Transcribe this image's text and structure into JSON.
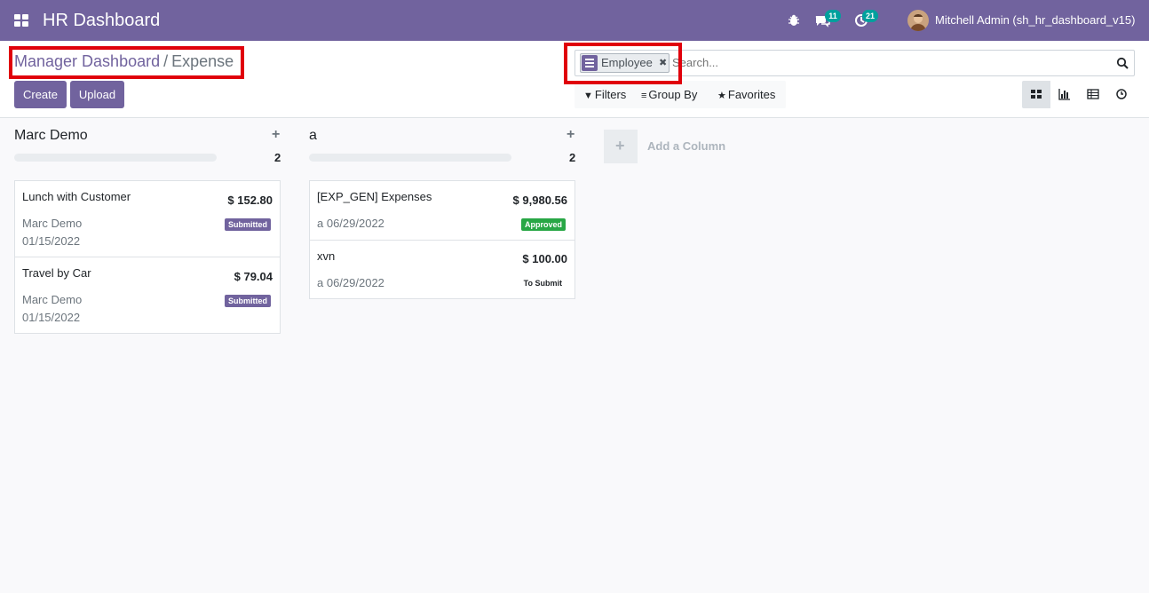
{
  "navbar": {
    "app_title": "HR Dashboard",
    "messages_count": "11",
    "activities_count": "21",
    "user_name": "Mitchell Admin (sh_hr_dashboard_v15)",
    "bg_color": "#71639e"
  },
  "breadcrumb": {
    "parent": "Manager Dashboard",
    "separator": "/",
    "current": "Expense"
  },
  "buttons": {
    "create": "Create",
    "upload": "Upload"
  },
  "search": {
    "facet_label": "Employee",
    "facet_close": "✖",
    "placeholder": "Search..."
  },
  "filters": {
    "filters_label": "Filters",
    "group_by_label": "Group By",
    "favorites_label": "Favorites"
  },
  "views": [
    "kanban-icon",
    "graph-icon",
    "list-icon",
    "activity-icon"
  ],
  "columns": [
    {
      "title": "Marc Demo",
      "count": "2",
      "cards": [
        {
          "name": "Lunch with Customer",
          "amount": "$ 152.80",
          "employee": "Marc Demo",
          "date": "01/15/2022",
          "state": "Submitted"
        },
        {
          "name": "Travel by Car",
          "amount": "$ 79.04",
          "employee": "Marc Demo",
          "date": "01/15/2022",
          "state": "Submitted"
        }
      ]
    },
    {
      "title": "a",
      "count": "2",
      "cards": [
        {
          "name": "[EXP_GEN] Expenses",
          "amount": "$ 9,980.56",
          "employee": "a 06/29/2022",
          "state": "Approved"
        },
        {
          "name": "xvn",
          "amount": "$ 100.00",
          "employee": "a 06/29/2022",
          "state": "To Submit"
        }
      ]
    }
  ],
  "add_column": {
    "plus": "+",
    "label": "Add a Column"
  },
  "colors": {
    "primary": "#71639e",
    "submitted": "#71639e",
    "approved": "#28a745",
    "highlight": "#e0000b",
    "counter_badge": "#00a09d"
  }
}
